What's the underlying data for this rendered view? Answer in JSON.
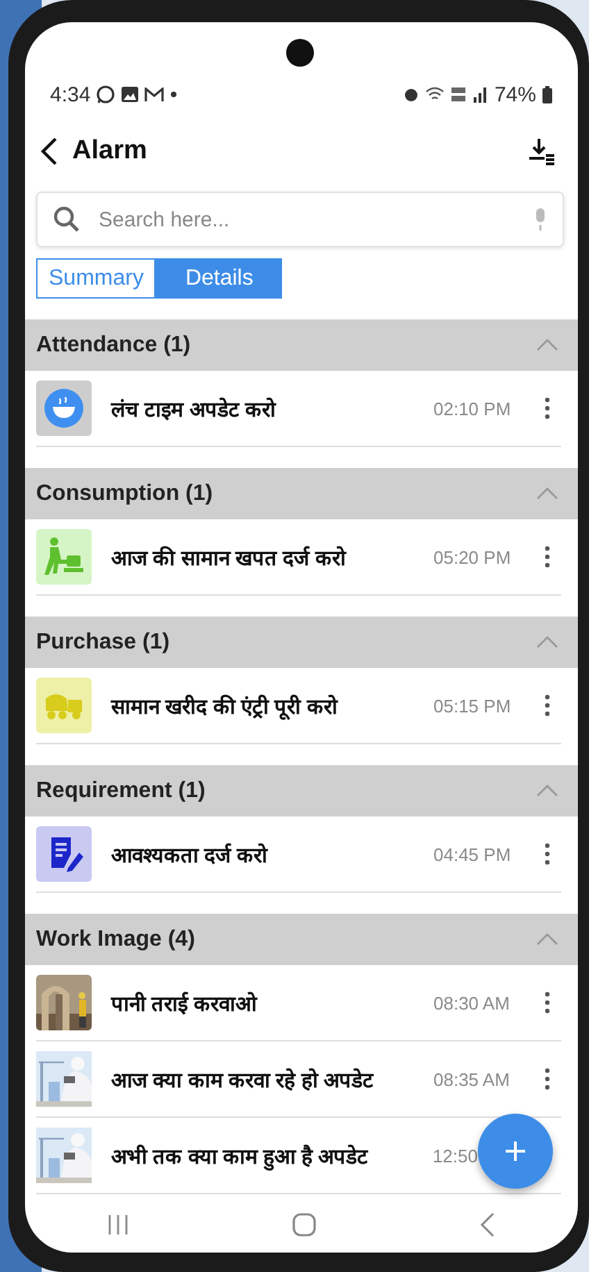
{
  "status_bar": {
    "time": "4:34",
    "battery": "74%"
  },
  "header": {
    "title": "Alarm"
  },
  "search": {
    "placeholder": "Search here..."
  },
  "tabs": [
    {
      "label": "Summary",
      "selected": false
    },
    {
      "label": "Details",
      "selected": true
    }
  ],
  "sections": [
    {
      "title": "Attendance (1)",
      "expanded": true,
      "items": [
        {
          "kind": "lunch",
          "text": "लंच टाइम अपडेट करो",
          "time": "02:10 PM",
          "menu": true
        }
      ]
    },
    {
      "title": "Consumption (1)",
      "expanded": true,
      "items": [
        {
          "kind": "consumption",
          "text": "आज की सामान खपत दर्ज करो",
          "time": "05:20 PM",
          "menu": true
        }
      ]
    },
    {
      "title": "Purchase (1)",
      "expanded": true,
      "items": [
        {
          "kind": "purchase",
          "text": "सामान खरीद की एंट्री पूरी करो",
          "time": "05:15 PM",
          "menu": true
        }
      ]
    },
    {
      "title": "Requirement (1)",
      "expanded": true,
      "items": [
        {
          "kind": "requirement",
          "text": "आवश्यकता दर्ज करो",
          "time": "04:45 PM",
          "menu": true
        }
      ]
    },
    {
      "title": "Work Image (4)",
      "expanded": true,
      "items": [
        {
          "kind": "picture",
          "text": "पानी तराई करवाओ",
          "time": "08:30 AM",
          "menu": true
        },
        {
          "kind": "picture",
          "text": "आज क्या काम करवा रहे हो अपडेट",
          "time": "08:35 AM",
          "menu": true
        },
        {
          "kind": "picture",
          "text": "अभी तक क्या काम हुआ है अपडेट",
          "time": "12:50",
          "menu": false
        }
      ]
    }
  ]
}
